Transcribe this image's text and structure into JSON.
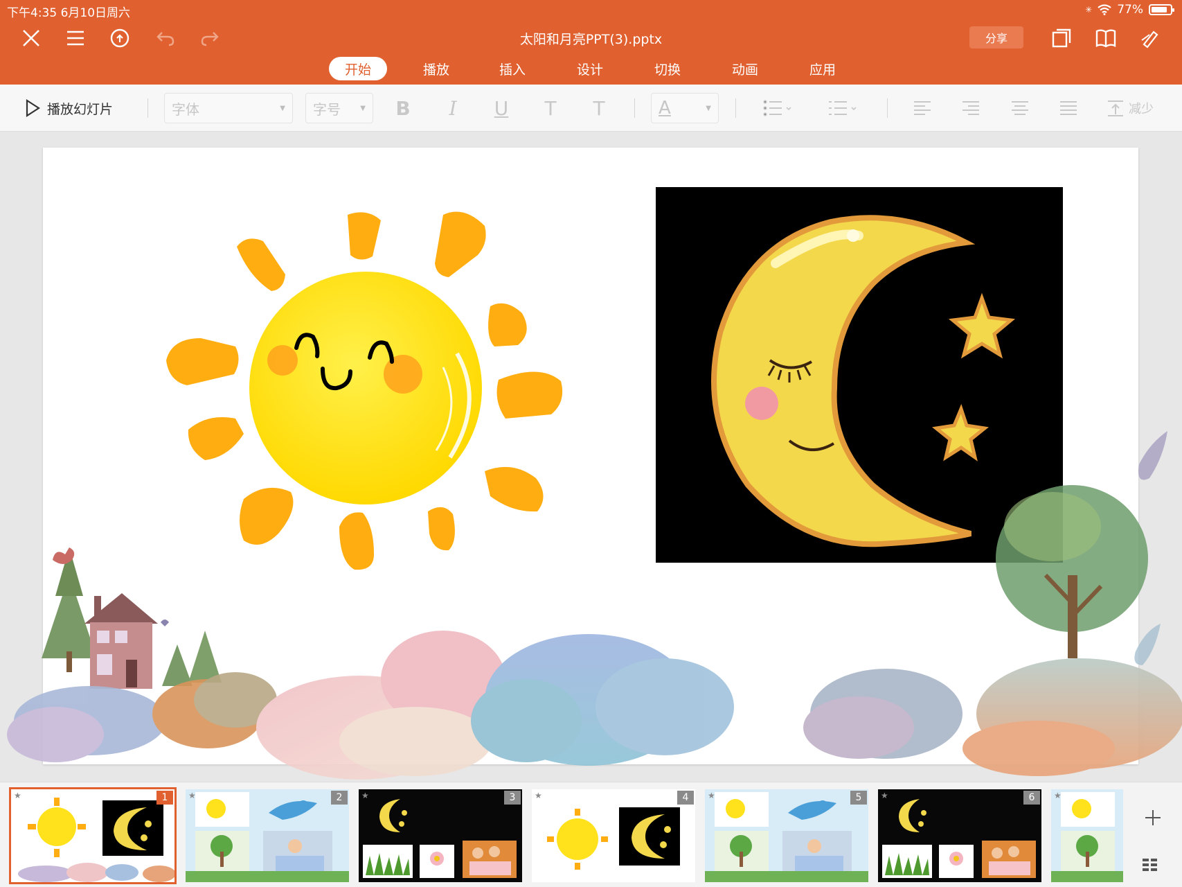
{
  "status_bar": {
    "time_date": "下午4:35   6月10日周六",
    "battery": "77%"
  },
  "document": {
    "title": "太阳和月亮PPT(3).pptx"
  },
  "toolbar": {
    "share_label": "分享"
  },
  "tabs": [
    {
      "label": "开始",
      "active": true
    },
    {
      "label": "播放",
      "active": false
    },
    {
      "label": "插入",
      "active": false
    },
    {
      "label": "设计",
      "active": false
    },
    {
      "label": "切换",
      "active": false
    },
    {
      "label": "动画",
      "active": false
    },
    {
      "label": "应用",
      "active": false
    }
  ],
  "format_bar": {
    "play_label": "播放幻灯片",
    "font_placeholder": "字体",
    "size_placeholder": "字号",
    "bold": "B",
    "italic": "I",
    "underline": "U",
    "superscript": "T",
    "subscript": "T",
    "font_color": "A",
    "trailing_label": "减少"
  },
  "slides": [
    {
      "number": "1",
      "selected": true
    },
    {
      "number": "2",
      "selected": false
    },
    {
      "number": "3",
      "selected": false
    },
    {
      "number": "4",
      "selected": false
    },
    {
      "number": "5",
      "selected": false
    },
    {
      "number": "6",
      "selected": false
    },
    {
      "number": "",
      "selected": false
    }
  ],
  "colors": {
    "accent": "#e0602f",
    "sun_body": "#ffe21b",
    "sun_rays": "#ffad10",
    "moon": "#f4d84c",
    "night_bg": "#000000"
  }
}
